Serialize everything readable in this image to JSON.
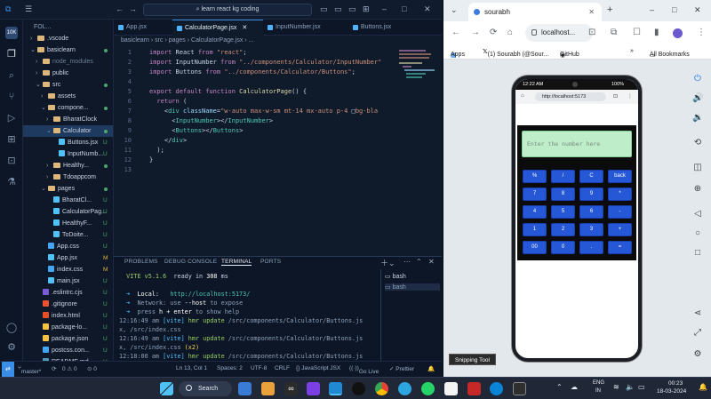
{
  "vscode": {
    "command_center": "learn react kg coding",
    "explorer_label": "FOL...",
    "tree": [
      {
        "label": ".vscode",
        "indent": 1,
        "type": "folder",
        "open": false,
        "badge": ""
      },
      {
        "label": "basiclearn",
        "indent": 1,
        "type": "folder",
        "open": true,
        "badge": "dot"
      },
      {
        "label": "node_modules",
        "indent": 2,
        "type": "folder",
        "open": false,
        "badge": "",
        "dim": true
      },
      {
        "label": "public",
        "indent": 2,
        "type": "folder",
        "open": false,
        "badge": ""
      },
      {
        "label": "src",
        "indent": 2,
        "type": "folder",
        "open": true,
        "badge": "dot"
      },
      {
        "label": "assets",
        "indent": 3,
        "type": "folder",
        "open": false,
        "badge": ""
      },
      {
        "label": "compone...",
        "indent": 3,
        "type": "folder",
        "open": true,
        "badge": "dot"
      },
      {
        "label": "BharatClock",
        "indent": 4,
        "type": "folder",
        "open": false,
        "badge": ""
      },
      {
        "label": "Calculator",
        "indent": 4,
        "type": "folder",
        "open": true,
        "badge": "dot",
        "selected": true
      },
      {
        "label": "Buttons.jsx",
        "indent": 5,
        "type": "react",
        "badge": "U"
      },
      {
        "label": "InputNumb...",
        "indent": 5,
        "type": "react",
        "badge": "U"
      },
      {
        "label": "Healthy...",
        "indent": 4,
        "type": "folder",
        "open": false,
        "badge": "dot"
      },
      {
        "label": "Tdoappcom",
        "indent": 4,
        "type": "folder",
        "open": false,
        "badge": ""
      },
      {
        "label": "pages",
        "indent": 3,
        "type": "folder",
        "open": true,
        "badge": "dot"
      },
      {
        "label": "BharatCl...",
        "indent": 4,
        "type": "react",
        "badge": "U"
      },
      {
        "label": "CalculatorPag...",
        "indent": 4,
        "type": "react",
        "badge": "U"
      },
      {
        "label": "HealthyF...",
        "indent": 4,
        "type": "react",
        "badge": "U"
      },
      {
        "label": "ToDoite...",
        "indent": 4,
        "type": "react",
        "badge": "U"
      },
      {
        "label": "App.css",
        "indent": 3,
        "type": "css",
        "badge": "U"
      },
      {
        "label": "App.jsx",
        "indent": 3,
        "type": "react",
        "badge": "M"
      },
      {
        "label": "index.css",
        "indent": 3,
        "type": "css",
        "badge": "M"
      },
      {
        "label": "main.jsx",
        "indent": 3,
        "type": "react",
        "badge": "U"
      },
      {
        "label": ".eslintrc.cjs",
        "indent": 2,
        "type": "eslint",
        "badge": "U"
      },
      {
        "label": ".gitignore",
        "indent": 2,
        "type": "git",
        "badge": "U"
      },
      {
        "label": "index.html",
        "indent": 2,
        "type": "html",
        "badge": "U"
      },
      {
        "label": "package-lo...",
        "indent": 2,
        "type": "json",
        "badge": "U"
      },
      {
        "label": "package.json",
        "indent": 2,
        "type": "json",
        "badge": "U"
      },
      {
        "label": "postcss.con...",
        "indent": 2,
        "type": "css",
        "badge": "U"
      },
      {
        "label": "README.md",
        "indent": 2,
        "type": "md",
        "badge": "U"
      }
    ],
    "tabs": [
      {
        "label": "App.jsx",
        "active": false
      },
      {
        "label": "CalculatorPage.jsx",
        "active": true
      },
      {
        "label": "InputNumber.jsx",
        "active": false
      },
      {
        "label": "Buttons.jsx",
        "active": false
      }
    ],
    "breadcrumb": [
      "basiclearn",
      "src",
      "pages",
      "CalculatorPage.jsx",
      "..."
    ],
    "code": [
      {
        "n": "1",
        "tokens": [
          [
            "kw",
            "import "
          ],
          [
            "pl",
            "React "
          ],
          [
            "kw",
            "from "
          ],
          [
            "st",
            "\"react\""
          ],
          [
            "pl",
            ";"
          ]
        ]
      },
      {
        "n": "2",
        "tokens": [
          [
            "kw",
            "import "
          ],
          [
            "pl",
            "InputNumber "
          ],
          [
            "kw",
            "from "
          ],
          [
            "st",
            "\"../components/Calculator/InputNumber\""
          ]
        ]
      },
      {
        "n": "3",
        "tokens": [
          [
            "kw",
            "import "
          ],
          [
            "pl",
            "Buttons "
          ],
          [
            "kw",
            "from "
          ],
          [
            "st",
            "\"../components/Calculator/Buttons\""
          ],
          [
            "pl",
            ";"
          ]
        ]
      },
      {
        "n": "4",
        "tokens": []
      },
      {
        "n": "5",
        "tokens": [
          [
            "kw",
            "export default function "
          ],
          [
            "fn",
            "CalculatorPage"
          ],
          [
            "pl",
            "() {"
          ]
        ]
      },
      {
        "n": "6",
        "tokens": [
          [
            "kw",
            "  return "
          ],
          [
            "pl",
            "("
          ]
        ]
      },
      {
        "n": "7",
        "tokens": [
          [
            "pl",
            "    <"
          ],
          [
            "tg",
            "div "
          ],
          [
            "at",
            "className"
          ],
          [
            "pl",
            "="
          ],
          [
            "st",
            "\"w-auto max-w-sm mt-14 mx-auto p-4 "
          ],
          [
            "pl",
            "□"
          ],
          [
            "st",
            "bg-bla"
          ]
        ]
      },
      {
        "n": "8",
        "tokens": [
          [
            "pl",
            "      <"
          ],
          [
            "tg",
            "InputNumber"
          ],
          [
            "pl",
            "></"
          ],
          [
            "tg",
            "InputNumber"
          ],
          [
            "pl",
            ">"
          ]
        ]
      },
      {
        "n": "9",
        "tokens": [
          [
            "pl",
            "      <"
          ],
          [
            "tg",
            "Buttons"
          ],
          [
            "pl",
            "></"
          ],
          [
            "tg",
            "Buttons"
          ],
          [
            "pl",
            ">"
          ]
        ]
      },
      {
        "n": "10",
        "tokens": [
          [
            "pl",
            "    </"
          ],
          [
            "tg",
            "div"
          ],
          [
            "pl",
            ">"
          ]
        ]
      },
      {
        "n": "11",
        "tokens": [
          [
            "pl",
            "  );"
          ]
        ]
      },
      {
        "n": "12",
        "tokens": [
          [
            "pl",
            "}"
          ]
        ]
      },
      {
        "n": "13",
        "tokens": []
      }
    ],
    "panel_tabs": [
      "PROBLEMS",
      "DEBUG CONSOLE",
      "TERMINAL",
      "PORTS"
    ],
    "active_panel_tab": "TERMINAL",
    "terminal_lines": [
      [
        [
          "#9ccc65",
          "  VITE "
        ],
        [
          "#9ccc65",
          "v5.1.6"
        ],
        [
          "#c8d3e0",
          "  ready in "
        ],
        [
          "#ffffff",
          "308"
        ],
        [
          "#c8d3e0",
          " ms"
        ]
      ],
      [
        [
          "#c8d3e0",
          ""
        ]
      ],
      [
        [
          "#4fc1ff",
          "  ➜  "
        ],
        [
          "#ffffff",
          "Local:   "
        ],
        [
          "#4ec9b0",
          "http://localhost:5173/"
        ]
      ],
      [
        [
          "#4fc1ff",
          "  ➜  "
        ],
        [
          "#8ea1ba",
          "Network: use "
        ],
        [
          "#ffffff",
          "--host"
        ],
        [
          "#8ea1ba",
          " to expose"
        ]
      ],
      [
        [
          "#4fc1ff",
          "  ➜  "
        ],
        [
          "#8ea1ba",
          "press "
        ],
        [
          "#ffffff",
          "h + enter"
        ],
        [
          "#8ea1ba",
          " to show help"
        ]
      ],
      [
        [
          "#8ea1ba",
          "12:16:49 am "
        ],
        [
          "#4fc1ff",
          "[vite] "
        ],
        [
          "#9ccc65",
          "hmr update "
        ],
        [
          "#8ea1ba",
          "/src/components/Calculator/Buttons.js"
        ]
      ],
      [
        [
          "#8ea1ba",
          "x, /src/index.css"
        ]
      ],
      [
        [
          "#8ea1ba",
          "12:16:49 am "
        ],
        [
          "#4fc1ff",
          "[vite] "
        ],
        [
          "#9ccc65",
          "hmr update "
        ],
        [
          "#8ea1ba",
          "/src/components/Calculator/Buttons.js"
        ]
      ],
      [
        [
          "#8ea1ba",
          "x, /src/index.css "
        ],
        [
          "#ffd54f",
          "(x2)"
        ]
      ],
      [
        [
          "#8ea1ba",
          "12:18:00 am "
        ],
        [
          "#4fc1ff",
          "[vite] "
        ],
        [
          "#9ccc65",
          "hmr update "
        ],
        [
          "#8ea1ba",
          "/src/components/Calculator/Buttons.js"
        ]
      ]
    ],
    "terminal_list": [
      "bash",
      "bash"
    ],
    "status": {
      "branch": "master*",
      "errors": "0 ⚠ 0",
      "warnings": "⊙ 0",
      "position": "Ln 13, Col 1",
      "spaces": "Spaces: 2",
      "encoding": "UTF-8",
      "eol": "CRLF",
      "language": "{} JavaScript JSX",
      "golive": "Go Live",
      "prettier": "✓ Prettier"
    }
  },
  "chrome": {
    "tab_title": "sourabh",
    "address": "localhost...",
    "bookmarks": [
      "Apps",
      "(1) Sourabh (@Sour...",
      "GitHub",
      "All Bookmarks"
    ],
    "phone": {
      "time": "12:22 AM",
      "battery": "100%",
      "url": "http://localhost:5173",
      "input_placeholder": "Enter the number here",
      "keys": [
        "%",
        "/",
        "C",
        "back",
        "7",
        "8",
        "9",
        "*",
        "4",
        "5",
        "6",
        "-",
        "1",
        "2",
        "3",
        "+",
        "00",
        "0",
        ".",
        "="
      ]
    }
  },
  "taskbar": {
    "search": "Search",
    "lang_top": "ENG",
    "lang_bottom": "IN",
    "time": "00:23",
    "date": "18-03-2024"
  },
  "snipping_tool": "Snipping Tool"
}
